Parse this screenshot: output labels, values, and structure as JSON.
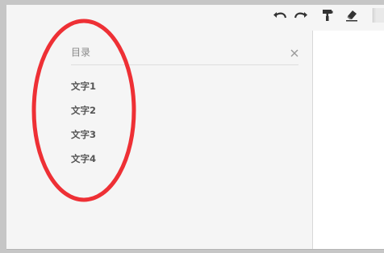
{
  "toolbar": {
    "undo_icon": "undo-icon",
    "redo_icon": "redo-icon",
    "format_painter_icon": "paint-roller-icon",
    "eraser_icon": "eraser-icon"
  },
  "outline": {
    "title": "目录",
    "close_icon": "close-icon",
    "items": [
      {
        "label": "文字1"
      },
      {
        "label": "文字2"
      },
      {
        "label": "文字3"
      },
      {
        "label": "文字4"
      }
    ]
  },
  "colors": {
    "annotation_ellipse": "#ee3035",
    "panel_background": "#f5f5f5",
    "page_background": "#ffffff",
    "outer_background": "#c6c6c6"
  }
}
